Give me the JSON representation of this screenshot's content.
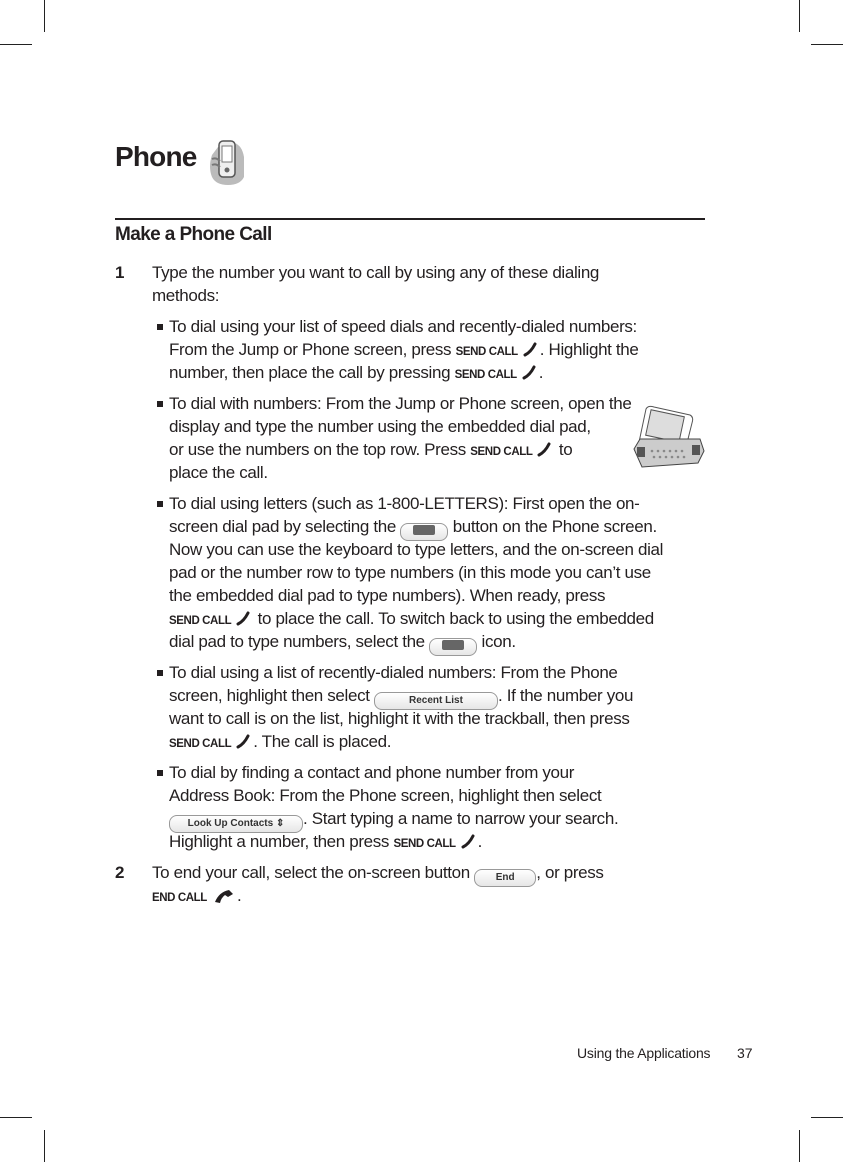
{
  "page": {
    "title": "Phone",
    "section_heading": "Make a Phone Call",
    "footer": {
      "section": "Using the Applications",
      "page_number": "37"
    }
  },
  "lines": [
    {
      "kind": "step",
      "marker": "1",
      "segments": [
        {
          "t": "Type the number you want to call by using any of these dialing"
        }
      ]
    },
    {
      "kind": "cont-step",
      "segments": [
        {
          "t": "methods:"
        }
      ]
    },
    {
      "kind": "bullet",
      "segments": [
        {
          "t": "To dial using your list of speed dials and recently-dialed numbers:"
        }
      ]
    },
    {
      "kind": "cont",
      "segments": [
        {
          "t": "From the Jump or Phone screen, press "
        },
        {
          "k": "SEND CALL"
        },
        {
          "icon": "send-call-icon"
        },
        {
          "t": ". Highlight the"
        }
      ]
    },
    {
      "kind": "cont",
      "segments": [
        {
          "t": "number, then place the call by pressing "
        },
        {
          "k": "SEND CALL"
        },
        {
          "icon": "send-call-icon"
        },
        {
          "t": "."
        }
      ]
    },
    {
      "kind": "bullet",
      "segments": [
        {
          "t": "To dial with numbers: From the Jump  or Phone screen, open the"
        }
      ]
    },
    {
      "kind": "cont",
      "segments": [
        {
          "t": "display and type the number using the embedded dial pad,"
        }
      ]
    },
    {
      "kind": "cont",
      "segments": [
        {
          "t": "or use the numbers on the top row. Press "
        },
        {
          "k": "SEND CALL"
        },
        {
          "icon": "send-call-icon"
        },
        {
          "t": "  to"
        }
      ]
    },
    {
      "kind": "cont",
      "segments": [
        {
          "t": "place the call."
        }
      ]
    },
    {
      "kind": "bullet",
      "segments": [
        {
          "t": "To dial using letters (such as 1-800-LETTERS): First open the on-"
        }
      ]
    },
    {
      "kind": "cont",
      "segments": [
        {
          "t": "screen dial pad by selecting the "
        },
        {
          "btn": "dialpad-button-icon",
          "w": 46
        },
        {
          "t": " button on the Phone screen."
        }
      ]
    },
    {
      "kind": "cont",
      "segments": [
        {
          "t": "Now you can use the keyboard to type letters, and the on-screen dial"
        }
      ]
    },
    {
      "kind": "cont",
      "segments": [
        {
          "t": "pad or the number row to type numbers (in this mode you can’t use"
        }
      ]
    },
    {
      "kind": "cont",
      "segments": [
        {
          "t": "the embedded dial pad to type numbers). When ready, press"
        }
      ]
    },
    {
      "kind": "cont",
      "segments": [
        {
          "k": "SEND CALL"
        },
        {
          "icon": "send-call-icon"
        },
        {
          "t": "  to place the call. To switch back to using the embedded"
        }
      ]
    },
    {
      "kind": "cont",
      "segments": [
        {
          "t": "dial pad to type numbers, select the "
        },
        {
          "btn": "keyboard-button-icon",
          "w": 46
        },
        {
          "t": " icon."
        }
      ]
    },
    {
      "kind": "bullet",
      "segments": [
        {
          "t": "To dial using a list of recently-dialed numbers: From the Phone"
        }
      ]
    },
    {
      "kind": "cont",
      "segments": [
        {
          "t": "screen, highlight then select "
        },
        {
          "btn": "recent-list-button",
          "label": "Recent List",
          "w": 122
        },
        {
          "t": ". If the number you"
        }
      ]
    },
    {
      "kind": "cont",
      "segments": [
        {
          "t": "want to call is on the list, highlight it with the trackball, then press"
        }
      ]
    },
    {
      "kind": "cont",
      "segments": [
        {
          "k": "SEND CALL"
        },
        {
          "icon": "send-call-icon"
        },
        {
          "t": ". The call is placed."
        }
      ]
    },
    {
      "kind": "bullet",
      "segments": [
        {
          "t": "To dial by finding a contact and phone number from your"
        }
      ]
    },
    {
      "kind": "cont",
      "segments": [
        {
          "t": "Address Book: From the Phone screen, highlight then select"
        }
      ]
    },
    {
      "kind": "cont",
      "segments": [
        {
          "btn": "look-up-contacts-button",
          "label": "Look Up Contacts ⇕",
          "w": 132
        },
        {
          "t": ". Start typing a name to narrow your search."
        }
      ]
    },
    {
      "kind": "cont",
      "segments": [
        {
          "t": "Highlight a number, then press "
        },
        {
          "k": "SEND CALL"
        },
        {
          "icon": "send-call-icon"
        },
        {
          "t": "."
        }
      ]
    },
    {
      "kind": "step",
      "marker": "2",
      "segments": [
        {
          "t": "To end your call, select the on-screen button "
        },
        {
          "btn": "end-button",
          "label": "End",
          "w": 60
        },
        {
          "t": ", or press"
        }
      ]
    },
    {
      "kind": "cont-step",
      "segments": [
        {
          "k": "END CALL"
        },
        {
          "icon": "end-call-icon"
        },
        {
          "t": "."
        }
      ]
    }
  ]
}
